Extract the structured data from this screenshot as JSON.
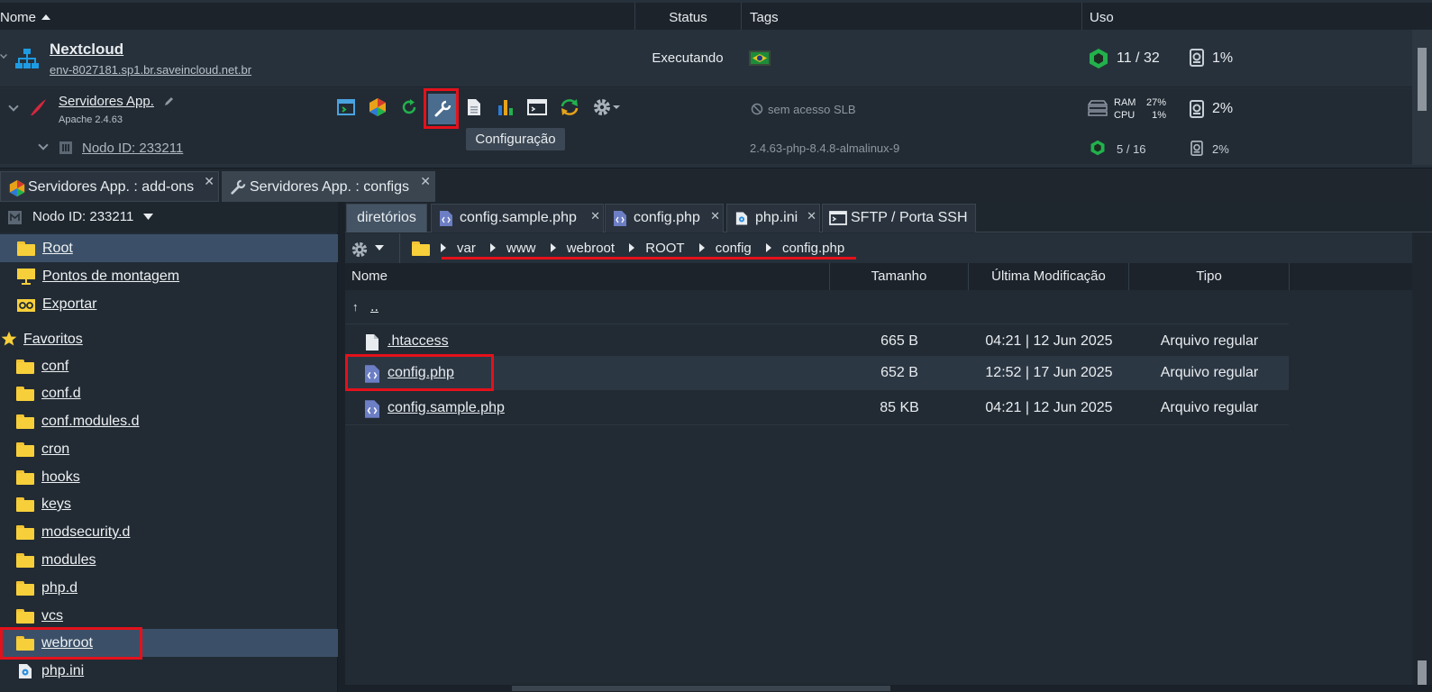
{
  "env_table": {
    "headers": {
      "name": "Nome",
      "status": "Status",
      "tags": "Tags",
      "usage": "Uso"
    },
    "environment": {
      "name": "Nextcloud",
      "domain": "env-8027181.sp1.br.saveincloud.net.br",
      "status": "Executando",
      "cloudlets": "11 / 32",
      "disk": "1%"
    },
    "app_server": {
      "name": "Servidores App.",
      "version": "Apache 2.4.63",
      "tag": "sem acesso SLB",
      "ram_label": "RAM",
      "ram_value": "27%",
      "cpu_label": "CPU",
      "cpu_value": "1%",
      "disk": "2%"
    },
    "node": {
      "name": "Nodo ID: 233211",
      "tag": "2.4.63-php-8.4.8-almalinux-9",
      "cloudlets": "5 / 16",
      "disk": "2%"
    },
    "tooltip": "Configuração"
  },
  "panel_tabs": [
    {
      "label": "Servidores App. : add-ons",
      "close": "✕"
    },
    {
      "label": "Servidores App. : configs",
      "close": "✕"
    }
  ],
  "left_panel": {
    "node_selector": "Nodo ID: 233211",
    "items": [
      {
        "label": "Root"
      },
      {
        "label": "Pontos de montagem"
      },
      {
        "label": "Exportar"
      }
    ],
    "favorites_label": "Favoritos",
    "favorites": [
      "conf",
      "conf.d",
      "conf.modules.d",
      "cron",
      "hooks",
      "keys",
      "modsecurity.d",
      "modules",
      "php.d",
      "vcs",
      "webroot",
      "php.ini"
    ]
  },
  "file_tabs": [
    {
      "label": "diretórios"
    },
    {
      "label": "config.sample.php",
      "close": "✕"
    },
    {
      "label": "config.php",
      "close": "✕"
    },
    {
      "label": "php.ini",
      "close": "✕"
    },
    {
      "label": "SFTP / Porta SSH"
    }
  ],
  "breadcrumb": [
    "var",
    "www",
    "webroot",
    "ROOT",
    "config",
    "config.php"
  ],
  "file_table": {
    "headers": {
      "name": "Nome",
      "size": "Tamanho",
      "modified": "Última Modificação",
      "type": "Tipo"
    },
    "up": "..",
    "rows": [
      {
        "name": ".htaccess",
        "size": "665 B",
        "modified": "04:21 | 12 Jun 2025",
        "type": "Arquivo regular"
      },
      {
        "name": "config.php",
        "size": "652 B",
        "modified": "12:52 | 17 Jun 2025",
        "type": "Arquivo regular"
      },
      {
        "name": "config.sample.php",
        "size": "85 KB",
        "modified": "04:21 | 12 Jun 2025",
        "type": "Arquivo regular"
      }
    ]
  },
  "colors": {
    "highlight_red": "#e4111b",
    "folder_yellow": "#f7cf3a",
    "selected_blue": "#3b5068",
    "green_cloudlet": "#22b14c"
  }
}
